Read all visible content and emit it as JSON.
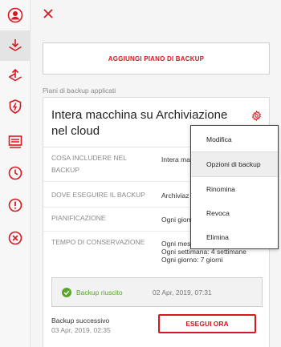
{
  "colors": {
    "accent": "#d7181f",
    "success": "#5aa52c"
  },
  "sidebar": {
    "items": [
      {
        "icon": "user-icon"
      },
      {
        "icon": "backup-download-icon",
        "active": true
      },
      {
        "icon": "deploy-icon"
      },
      {
        "icon": "protection-shield-icon"
      },
      {
        "icon": "report-icon"
      },
      {
        "icon": "clock-icon"
      },
      {
        "icon": "alert-icon"
      },
      {
        "icon": "cancel-icon"
      }
    ]
  },
  "panel": {
    "close_icon": "close-icon",
    "add_button": "AGGIUNGI PIANO DI BACKUP",
    "section_label": "Piani di backup applicati"
  },
  "plan": {
    "title": "Intera macchina su Archiviazione nel cloud",
    "gear_icon": "gear-icon",
    "rows": [
      {
        "label": "COSA INCLUDERE NEL BACKUP",
        "value": "Intera ma"
      },
      {
        "label": "DOVE ESEGUIRE IL BACKUP",
        "value": "Archiviaz"
      },
      {
        "label": "PIANIFICAZIONE",
        "value": "Ogni giorn"
      },
      {
        "label": "TEMPO DI CONSERVAZIONE",
        "value_lines": [
          "Ogni mes",
          "Ogni settimana: 4 settimane",
          "Ogni giorno: 7 giorni"
        ]
      }
    ],
    "status": {
      "text": "Backup riuscito",
      "date": "02 Apr, 2019, 07:31"
    },
    "next_backup": {
      "label": "Backup successivo",
      "date": "03 Apr, 2019, 02:35"
    },
    "run_button": "ESEGUI ORA"
  },
  "menu": {
    "items": [
      {
        "label": "Modifica"
      },
      {
        "label": "Opzioni di backup",
        "highlighted": true
      },
      {
        "label": "Rinomina"
      },
      {
        "label": "Revoca"
      },
      {
        "label": "Elimina"
      }
    ]
  }
}
